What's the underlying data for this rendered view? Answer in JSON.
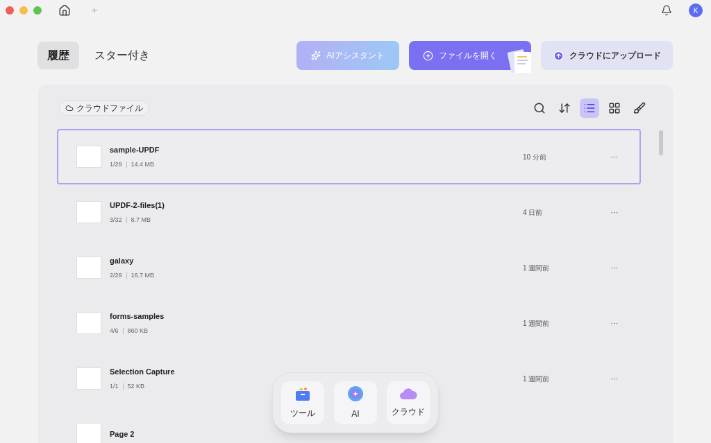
{
  "titlebar": {
    "avatar": "K"
  },
  "tabs": [
    {
      "label": "履歴",
      "selected": true
    },
    {
      "label": "スター付き",
      "selected": false
    }
  ],
  "actions": [
    {
      "kind": "ai",
      "label": "AIアシスタント"
    },
    {
      "kind": "open",
      "label": "ファイルを開く"
    },
    {
      "kind": "upload",
      "label": "クラウドにアップロード"
    }
  ],
  "filter": {
    "label": "クラウドファイル"
  },
  "toolbar": [
    {
      "kind": "search",
      "selected": false
    },
    {
      "kind": "sort",
      "selected": false
    },
    {
      "kind": "list",
      "selected": true
    },
    {
      "kind": "grid",
      "selected": false
    },
    {
      "kind": "clean",
      "selected": false
    }
  ],
  "files": [
    {
      "name": "sample-UPDF",
      "pages": "1/29",
      "size": "14.4 MB",
      "time": "10 分前",
      "menu": "···",
      "selected": true
    },
    {
      "name": "UPDF-2-files(1)",
      "pages": "3/32",
      "size": "8.7 MB",
      "time": "4 日前",
      "menu": "···",
      "selected": false
    },
    {
      "name": "galaxy",
      "pages": "2/29",
      "size": "16.7 MB",
      "time": "1 週間前",
      "menu": "···",
      "selected": false
    },
    {
      "name": "forms-samples",
      "pages": "4/6",
      "size": "860 KB",
      "time": "1 週間前",
      "menu": "···",
      "selected": false
    },
    {
      "name": "Selection Capture",
      "pages": "1/1",
      "size": "52 KB",
      "time": "1 週間前",
      "menu": "···",
      "selected": false
    },
    {
      "name": "Page 2",
      "selected": false
    }
  ],
  "dock": [
    {
      "kind": "tools",
      "label": "ツール"
    },
    {
      "kind": "ai",
      "label": "AI"
    },
    {
      "kind": "cloud",
      "label": "クラウド"
    }
  ]
}
